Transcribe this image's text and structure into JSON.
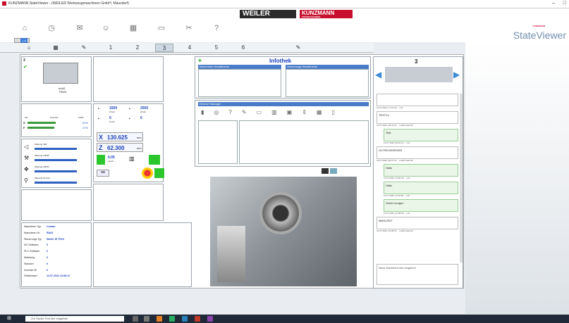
{
  "window": {
    "title": "KUNZMANN StateViewer - (WEILER Werkzeugmaschinen GmbH, Mausdorf)"
  },
  "brand": {
    "weiler": "WEILER",
    "kunzmann": "KUNZMANN",
    "kunzmann_sub": "FRÄSMASCHINEN",
    "app": "StateViewer",
    "app_small": "KUNZMANN"
  },
  "nav": {
    "page": "1-8"
  },
  "tabs": [
    "1",
    "2",
    "3",
    "4",
    "5",
    "6"
  ],
  "machine": {
    "id": "3",
    "name": "eubD",
    "name2": "TSW3"
  },
  "override": {
    "label": "Override",
    "min": "0%",
    "max": "100%",
    "s_label": "S",
    "s_val": "50%",
    "f_label": "F",
    "f_val": "47%"
  },
  "maint": [
    "Wartung 4Wt",
    "Wartung 100Wt",
    "Wartung 200Wt",
    "Wartung Service"
  ],
  "spindle": {
    "v1": "1500",
    "u1": "U/min",
    "v2": "2500",
    "u2": "U/min",
    "v3": "0",
    "u3": "U/min",
    "v4": "0"
  },
  "axes": {
    "x_label": "X",
    "x": "130.625",
    "x_unit": "mm",
    "z_label": "Z",
    "z": "62.300",
    "z_unit": "mm"
  },
  "feed": {
    "v": "0.05",
    "u": "mm/U"
  },
  "info": {
    "rows": [
      [
        "Maschinen Typ",
        "Condor"
      ],
      [
        "Maschinen Nr.",
        "RA04"
      ],
      [
        "Steuerungs Typ",
        "Weiler W TS19"
      ],
      [
        "NC-Software",
        "0"
      ],
      [
        "PLC-Software",
        "0"
      ],
      [
        "Abteilung",
        "0"
      ],
      [
        "Standort",
        "0"
      ],
      [
        "Inventar Nr.",
        "0"
      ],
      [
        "Zeitstempel",
        "14.07.2022 12:08:11"
      ]
    ]
  },
  "infothek": {
    "title": "Infothek",
    "col1": "Maschinen Handbücher",
    "col2": "Steuerungs Handbücher",
    "service": "Service Manager"
  },
  "chat_panel": {
    "id": "3",
    "messages": [
      {
        "text": "",
        "ts": "13.07.2022_17:41:30 ... info",
        "w": true
      },
      {
        "text": "TEST12",
        "ts": "13.07.2022_08:42:00 ... eubD2 aacc42",
        "w": true
      },
      {
        "text": "Test",
        "ts": "13.07.2022_08:42:13 ... info",
        "w": false
      },
      {
        "text": "GUTEN MORGEN",
        "ts": "13.07.2022_08:47:41 ... eubD2 aacc42",
        "w": true
      },
      {
        "text": "Hallo",
        "ts": "13.07.2022_10:09:48 ... info",
        "w": false
      },
      {
        "text": "Hallo",
        "ts": "14.07.2022_11:23:09 ... info",
        "w": false
      },
      {
        "text": "Guten morgen",
        "ts": "14.07.2022_12:08:08 ... info",
        "w": false
      },
      {
        "text": "MAHLZEIT",
        "ts": "14.07.2022_12:08:30 ... eubD2 aacc42",
        "w": true
      }
    ],
    "input_placeholder": "Neue Nachricht hier eingeben"
  },
  "taskbar": {
    "search": "Zur Suche Text hier eingeben"
  }
}
